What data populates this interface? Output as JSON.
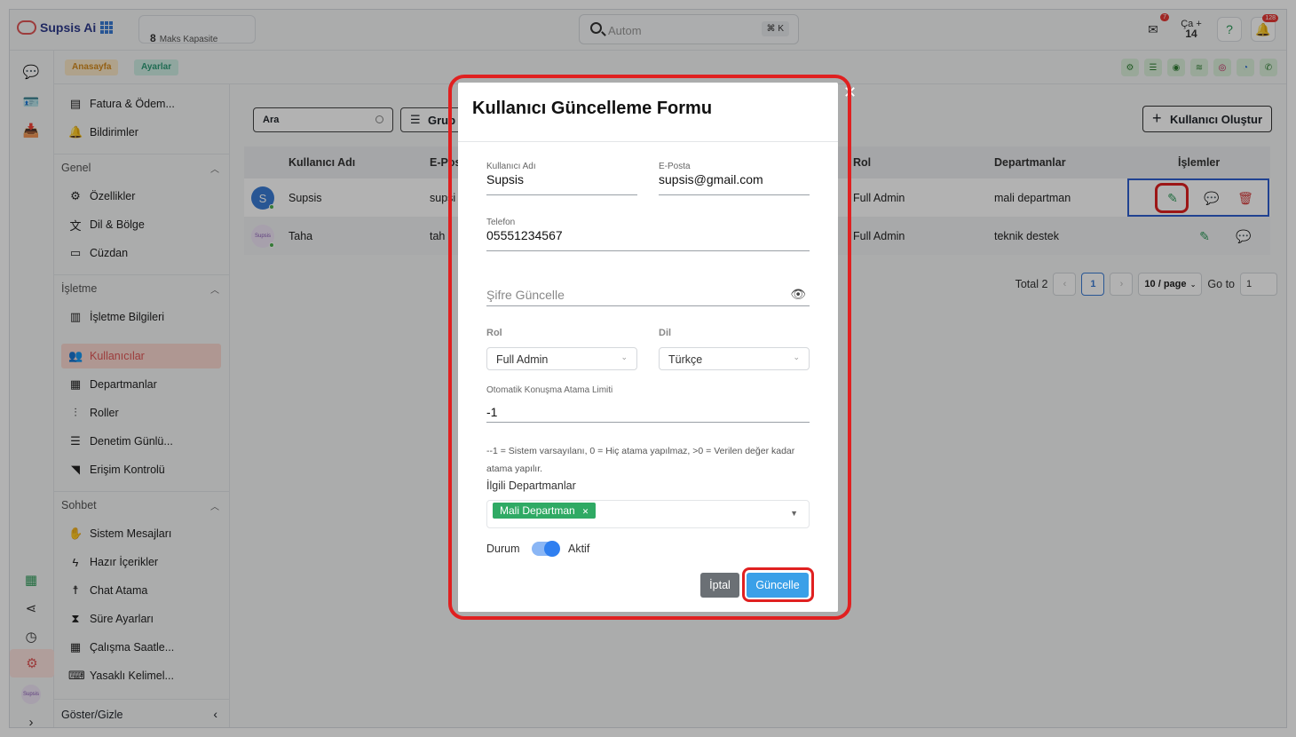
{
  "app": {
    "brand": "Supsis Ai",
    "capacity_num": "8",
    "capacity_label": "Maks Kapasite",
    "search_placeholder": "Autom",
    "search_shortcut": "⌘ K",
    "mail_badge": "7",
    "date_day": "Ça",
    "date_num": "14",
    "notif_badge": "128"
  },
  "breadcrumb": {
    "home": "Anasayfa",
    "settings": "Ayarlar"
  },
  "sidebar": {
    "top_items": [
      "Fatura & Ödem...",
      "Bildirimler"
    ],
    "sections": [
      {
        "title": "Genel",
        "items": [
          "Özellikler",
          "Dil & Bölge",
          "Cüzdan"
        ]
      },
      {
        "title": "İşletme",
        "items": [
          "İşletme Bilgileri",
          "Kullanıcılar",
          "Departmanlar",
          "Roller",
          "Denetim Günlü...",
          "Erişim Kontrolü"
        ]
      },
      {
        "title": "Sohbet",
        "items": [
          "Sistem Mesajları",
          "Hazır İçerikler",
          "Chat Atama",
          "Süre Ayarları",
          "Çalışma Saatle...",
          "Yasaklı Kelimel..."
        ]
      }
    ],
    "active_item": "Kullanıcılar",
    "footer": "Göster/Gizle"
  },
  "main": {
    "search_placeholder": "Ara",
    "filter_label": "Grup",
    "create_button": "Kullanıcı Oluştur",
    "table": {
      "headers": [
        "Kullanıcı Adı",
        "E-Pos",
        "Rol",
        "Departmanlar",
        "İşlemler"
      ],
      "rows": [
        {
          "avatar": "S",
          "name": "Supsis",
          "email": "supsi",
          "role": "Full Admin",
          "dept": "mali departman"
        },
        {
          "avatar": "Supsis",
          "name": "Taha",
          "email": "tah",
          "role": "Full Admin",
          "dept": "teknik destek"
        }
      ]
    },
    "pager": {
      "total": "Total 2",
      "page": "1",
      "size": "10 / page",
      "goto_label": "Go to",
      "goto_value": "1"
    }
  },
  "modal": {
    "title": "Kullanıcı Güncelleme Formu",
    "username_label": "Kullanıcı Adı",
    "username_value": "Supsis",
    "email_label": "E-Posta",
    "email_value": "supsis@gmail.com",
    "phone_label": "Telefon",
    "phone_value": "05551234567",
    "password_placeholder": "Şifre Güncelle",
    "role_label": "Rol",
    "role_value": "Full Admin",
    "lang_label": "Dil",
    "lang_value": "Türkçe",
    "limit_label": "Otomatik Konuşma Atama Limiti",
    "limit_value": "-1",
    "hint": "--1 = Sistem varsayılanı, 0 = Hiç atama yapılmaz, >0 = Verilen değer kadar atama yapılır.",
    "dept_label": "İlgili Departmanlar",
    "dept_chip": "Mali Departman",
    "status_label": "Durum",
    "status_value": "Aktif",
    "cancel": "İptal",
    "save": "Güncelle"
  }
}
